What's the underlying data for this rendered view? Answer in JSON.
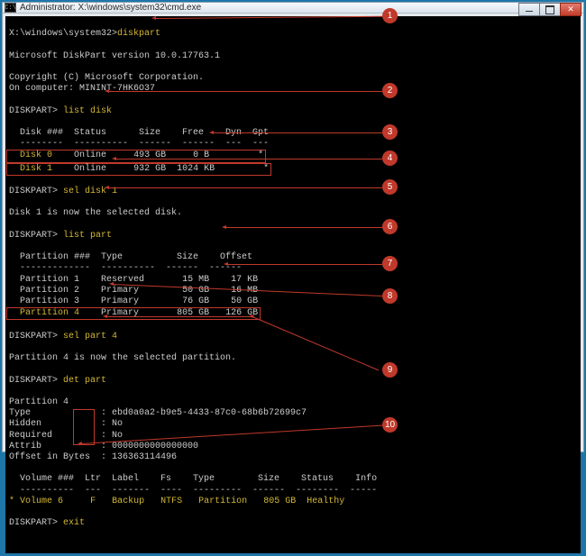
{
  "window_title": "Administrator: X:\\windows\\system32\\cmd.exe",
  "prompt1_path": "X:\\windows\\system32>",
  "cmd_diskpart": "diskpart",
  "version_line": "Microsoft DiskPart version 10.0.17763.1",
  "copyright_line": "Copyright (C) Microsoft Corporation.",
  "computer_line": "On computer: MININT-7HK6O37",
  "dp_prompt": "DISKPART>",
  "cmd_list_disk": "list disk",
  "disk_header": "  Disk ###  Status      Size    Free    Dyn  Gpt",
  "disk_header_rule": "  --------  ----------  ------  ------  ---  ---",
  "disk_rows": [
    {
      "name": "Disk 0",
      "status": "Online",
      "size": "493 GB",
      "free": "0 B",
      "gpt": "*"
    },
    {
      "name": "Disk 1",
      "status": "Online",
      "size": "932 GB",
      "free": "1024 KB",
      "gpt": "*"
    }
  ],
  "cmd_sel_disk": "sel disk 1",
  "sel_disk_result": "Disk 1 is now the selected disk.",
  "cmd_list_part": "list part",
  "part_header": "  Partition ###  Type          Size    Offset",
  "part_header_rule": "  -------------  ----------  ------  ------",
  "part_rows": [
    {
      "name": "Partition 1",
      "type": "Reserved",
      "size": "15 MB",
      "offset": "17 KB"
    },
    {
      "name": "Partition 2",
      "type": "Primary",
      "size": "50 GB",
      "offset": "16 MB"
    },
    {
      "name": "Partition 3",
      "type": "Primary",
      "size": "76 GB",
      "offset": "50 GB"
    },
    {
      "name": "Partition 4",
      "type": "Primary",
      "size": "805 GB",
      "offset": "126 GB"
    }
  ],
  "cmd_sel_part": "sel part 4",
  "sel_part_result": "Partition 4 is now the selected partition.",
  "cmd_det_part": "det part",
  "det_name": "Partition 4",
  "det_type": "Type             : ebd0a0a2-b9e5-4433-87c0-68b6b72699c7",
  "det_hidden": "Hidden           : No",
  "det_required": "Required         : No",
  "det_attrib": "Attrib           : 0000000000000000",
  "det_offset": "Offset in Bytes  : 136363114496",
  "vol_header": "  Volume ###  Ltr  Label    Fs    Type        Size    Status    Info",
  "vol_header_rule": "  ----------  ---  -------  ----  ---------  ------  --------  -----",
  "vol_row": {
    "marker": "*",
    "name": "Volume 6",
    "ltr": "F",
    "label": "Backup",
    "fs": "NTFS",
    "type": "Partition",
    "size": "805 GB",
    "status": "Healthy"
  },
  "cmd_exit": "exit",
  "markers": [
    "1",
    "2",
    "3",
    "4",
    "5",
    "6",
    "7",
    "8",
    "9",
    "10"
  ]
}
